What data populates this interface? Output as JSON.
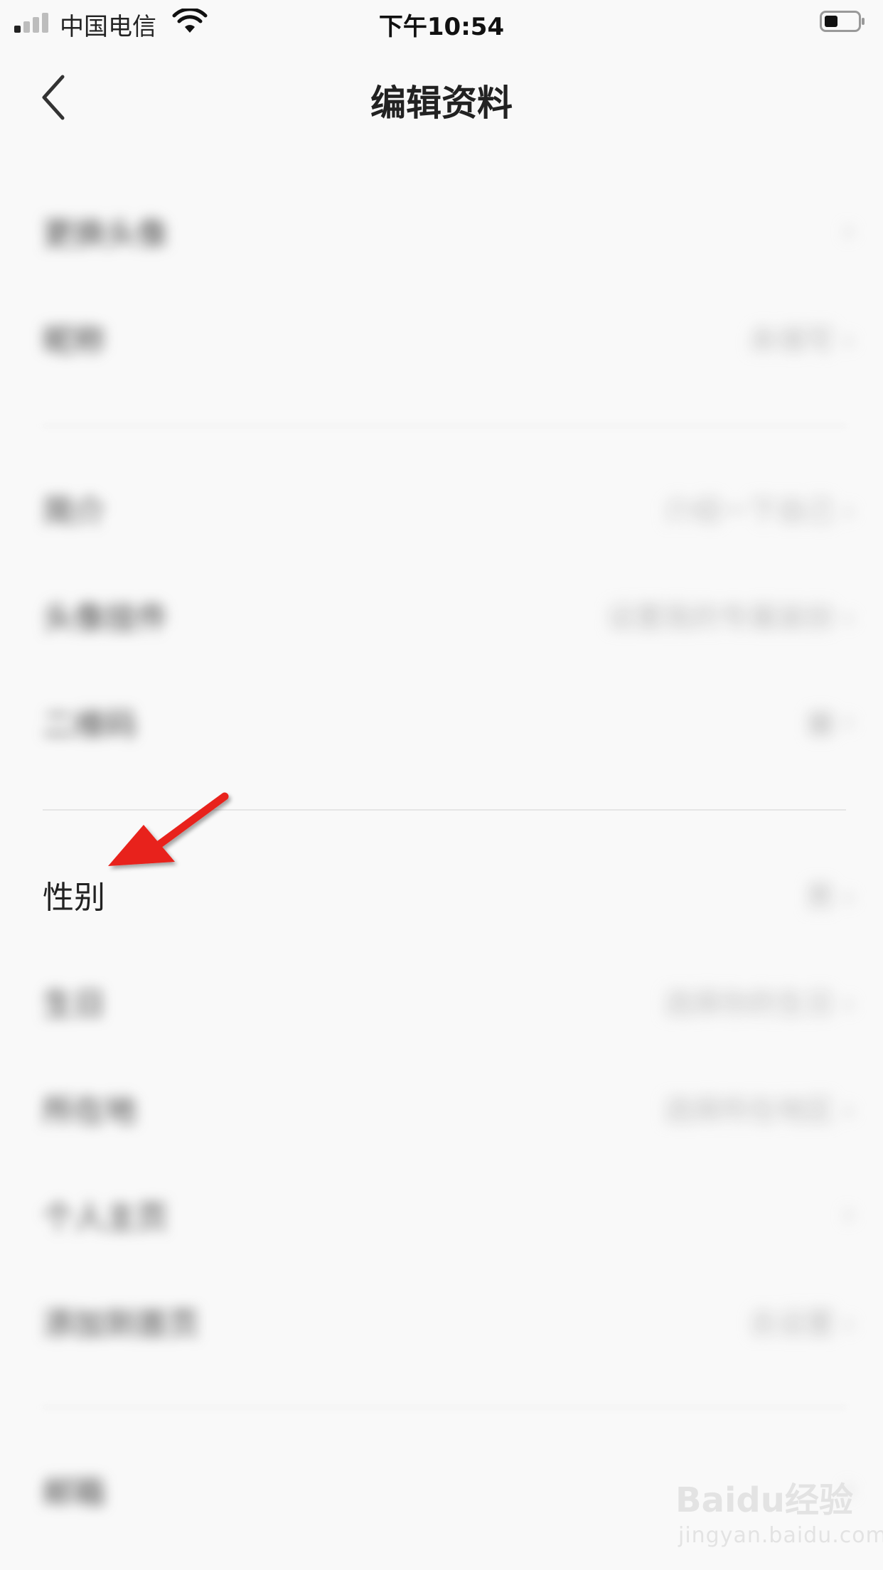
{
  "status_bar": {
    "carrier": "中国电信",
    "time": "下午10:54"
  },
  "header": {
    "title": "编辑资料"
  },
  "rows": [
    {
      "label": "更换头像",
      "value": "›",
      "blurred": true
    },
    {
      "label": "昵称",
      "value": "未填写 ›",
      "blurred": true
    },
    {
      "label": "简介",
      "value": "介绍一下自己 ›",
      "blurred": true
    },
    {
      "label": "头像挂件",
      "value": "设置我的专属装扮 ›",
      "blurred": true
    },
    {
      "label": "二维码",
      "value": "▦ ›",
      "blurred": true
    },
    {
      "label": "性别",
      "value": "男 ›",
      "blurred": false
    },
    {
      "label": "生日",
      "value": "选择你的生日 ›",
      "blurred": true
    },
    {
      "label": "所在地",
      "value": "选择所在地区 ›",
      "blurred": true
    },
    {
      "label": "个人主页",
      "value": "›",
      "blurred": true
    },
    {
      "label": "添加到首页",
      "value": "去设置 ›",
      "blurred": true
    },
    {
      "label": "邮箱",
      "value": "›",
      "blurred": true
    }
  ],
  "annotation": {
    "arrow_color": "#e8201a"
  },
  "watermark": {
    "logo": "Baidu经验",
    "url": "jingyan.baidu.com"
  }
}
